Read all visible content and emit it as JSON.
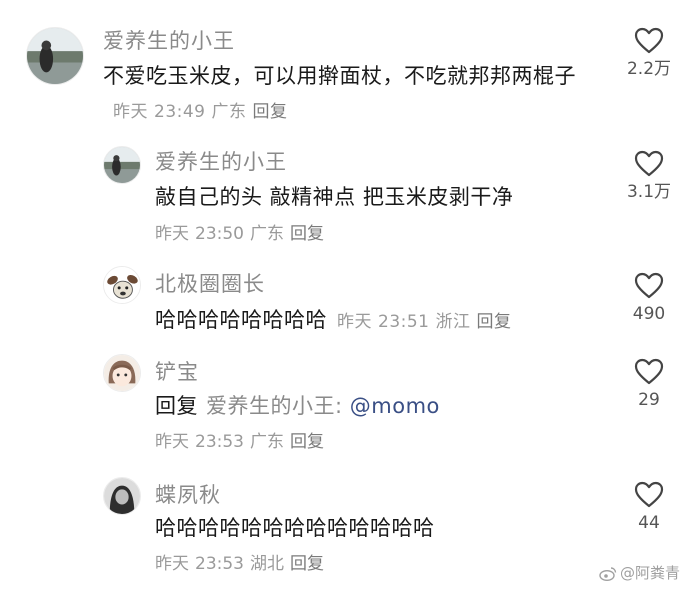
{
  "comments": [
    {
      "username": "爱养生的小王",
      "text": "不爱吃玉米皮，可以用擀面杖，不吃就邦邦两棍子",
      "date": "昨天",
      "time": "23:49",
      "location": "广东",
      "reply_label": "回复",
      "likes": "2.2万"
    },
    {
      "username": "爱养生的小王",
      "text": "敲自己的头 敲精神点 把玉米皮剥干净",
      "date": "昨天",
      "time": "23:50",
      "location": "广东",
      "reply_label": "回复",
      "likes": "3.1万"
    },
    {
      "username": "北极圈圈长",
      "text": "哈哈哈哈哈哈哈哈",
      "date": "昨天",
      "time": "23:51",
      "location": "浙江",
      "reply_label": "回复",
      "likes": "490"
    },
    {
      "username": "铲宝",
      "reply_prefix": "回复",
      "reply_to": "爱养生的小王:",
      "mention": "@momo",
      "date": "昨天",
      "time": "23:53",
      "location": "广东",
      "reply_label": "回复",
      "likes": "29"
    },
    {
      "username": "蝶夙秋",
      "text": "哈哈哈哈哈哈哈哈哈哈哈哈哈",
      "date": "昨天",
      "time": "23:53",
      "location": "湖北",
      "reply_label": "回复",
      "likes": "44"
    }
  ],
  "watermark": "@阿粪青",
  "icons": {
    "like": "heart-outline-icon",
    "watermark": "weibo-icon"
  }
}
